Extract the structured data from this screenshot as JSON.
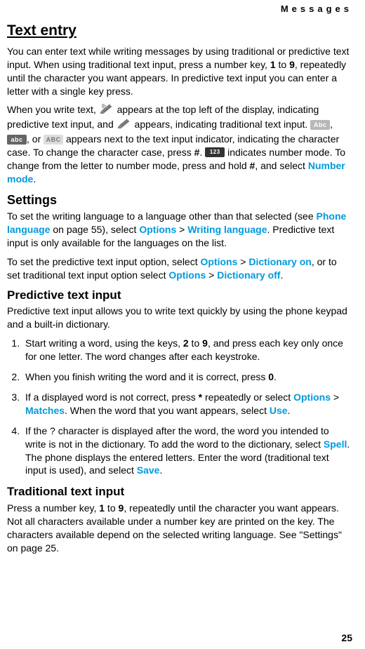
{
  "header": {
    "section_label": "Messages"
  },
  "h1": "Text entry",
  "intro": {
    "p1_a": "You can enter text while writing messages by using traditional or predictive text input. When using traditional text input, press a number key, ",
    "p1_b": "1",
    "p1_c": " to ",
    "p1_d": "9",
    "p1_e": ", repeatedly until the character you want appears. In predictive text input you can enter a letter with a single key press.",
    "p2_a": "When you write text, ",
    "p2_b": " appears at the top left of the display, indicating predictive text input, and ",
    "p2_c": " appears, indicating traditional text input. ",
    "p2_d": ", ",
    "p2_e": ", or ",
    "p2_f": " appears next to the text input indicator, indicating the character case. To change the character case, press ",
    "p2_g": "#",
    "p2_h": ". ",
    "p2_i": " indicates number mode. To change from the letter to number mode, press and hold ",
    "p2_j": "#",
    "p2_k": ", and select ",
    "p2_link": "Number mode",
    "p2_l": "."
  },
  "settings": {
    "h2": "Settings",
    "p1_a": "To set the writing language to a language other than that selected (see ",
    "p1_link1": "Phone language",
    "p1_b": " on page 55), select ",
    "p1_link2": "Options",
    "p1_c": " > ",
    "p1_link3": "Writing language",
    "p1_d": ". Predictive text input is only available for the languages on the list.",
    "p2_a": "To set the predictive text input option, select ",
    "p2_link1": "Options",
    "p2_b": " > ",
    "p2_link2": "Dictionary on",
    "p2_c": ", or to set traditional text input option select ",
    "p2_link3": "Options",
    "p2_d": " > ",
    "p2_link4": "Dictionary off",
    "p2_e": "."
  },
  "predictive": {
    "h3": "Predictive text input",
    "intro": "Predictive text input allows you to write text quickly by using the phone keypad and a built-in dictionary.",
    "step1_a": "Start writing a word, using the keys, ",
    "step1_b": "2",
    "step1_c": " to ",
    "step1_d": "9",
    "step1_e": ", and press each key only once for one letter. The word changes after each keystroke.",
    "step2_a": "When you finish writing the word and it is correct, press ",
    "step2_b": "0",
    "step2_c": ".",
    "step3_a": "If a displayed word is not correct, press ",
    "step3_b": "*",
    "step3_c": " repeatedly or select ",
    "step3_link1": "Options",
    "step3_d": " > ",
    "step3_link2": "Matches",
    "step3_e": ". When the word that you want appears, select ",
    "step3_link3": "Use",
    "step3_f": ".",
    "step4_a": "If the ? character is displayed after the word, the word you intended to write is not in the dictionary. To add the word to the dictionary, select ",
    "step4_link1": "Spell",
    "step4_b": ". The phone displays the entered letters. Enter the word (traditional text input is used), and select ",
    "step4_link2": "Save",
    "step4_c": "."
  },
  "traditional": {
    "h3": "Traditional text input",
    "p_a": "Press a number key, ",
    "p_b": "1",
    "p_c": " to ",
    "p_d": "9",
    "p_e": ", repeatedly until the character you want appears. Not all characters available under a number key are printed on the key. The characters available depend on the selected writing language. See \"Settings\" on page 25."
  },
  "icon_labels": {
    "abc_upper_a": "Abc",
    "abc_lower": "abc",
    "abc_upper": "ABC",
    "num": "123"
  },
  "page_number": "25"
}
